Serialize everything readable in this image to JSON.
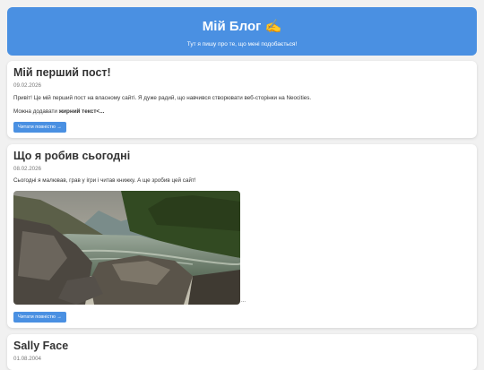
{
  "header": {
    "title": "Мій Блог ✍️",
    "subtitle": "Тут я пишу про те, що мені подобається!"
  },
  "posts": [
    {
      "title": "Мій перший пост!",
      "date": "09.02.2026",
      "text": "Привіт! Це мій перший пост на власному сайті. Я дуже радий, що навчився створювати веб-сторінки на Neocities.",
      "text2_prefix": "Можна додавати ",
      "text2_bold": "жирний текст<...",
      "button": "Читати повністю →"
    },
    {
      "title": "Що я робив сьогодні",
      "date": "08.02.2026",
      "text": "Сьогодні я малював, грав у ігри і читав книжку. А ще зробив цей сайт!",
      "after_image": "...",
      "button": "Читати повністю →"
    },
    {
      "title": "Sally Face",
      "date": "01.08.2004"
    }
  ],
  "colors": {
    "accent": "#4a90e2",
    "background": "#f1f1f1"
  }
}
